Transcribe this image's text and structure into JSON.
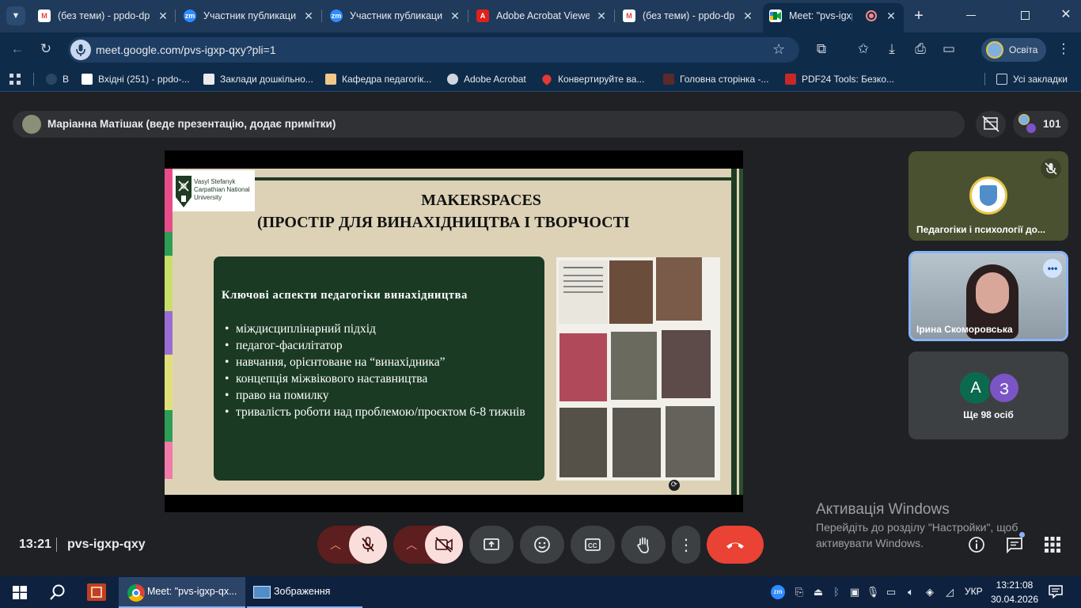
{
  "tabs": [
    {
      "label": "(без теми) - ppdo-dp",
      "icon": "gmail-icon"
    },
    {
      "label": "Участник публикаци",
      "icon": "zoom-icon"
    },
    {
      "label": "Участник публикаци",
      "icon": "zoom-icon"
    },
    {
      "label": "Adobe Acrobat Viewe",
      "icon": "acrobat-icon"
    },
    {
      "label": "(без теми) - ppdo-dp",
      "icon": "gmail-icon"
    },
    {
      "label": "Meet: \"pvs-igxp-q",
      "icon": "meet-icon"
    }
  ],
  "address": {
    "url": "meet.google.com/pvs-igxp-qxy?pli=1"
  },
  "profile": {
    "label": "Освіта"
  },
  "bookmarks": {
    "items": [
      "В",
      "Вхідні (251) - ppdo-...",
      "Заклади дошкільно...",
      "Кафедра педагогік...",
      "Adobe Acrobat",
      "Конвертируйте ва...",
      "Головна сторінка -...",
      "PDF24 Tools: Безко..."
    ],
    "all_label": "Усі закладки"
  },
  "presenter": {
    "text": "Маріанна Матішак (веде презентацію, додає примітки)",
    "participant_count": "101"
  },
  "slide": {
    "logo_lines": [
      "Vasyl Stefanyk",
      "Carpathian National",
      "University"
    ],
    "title_line1": "MAKERSPACES",
    "title_line2": "(ПРОСТІР ДЛЯ ВИНАХІДНИЦТВА І ТВОРЧОСТІ",
    "box_heading": "Ключові аспекти педагогіки винахідництва",
    "bullets": [
      "міждисциплінарний підхід",
      "педагог-фасилітатор",
      "навчання, орієнтоване на “винахідника”",
      "концепція міжвікового наставництва",
      "право на помилку",
      "тривалість роботи над проблемою/проєктом 6-8 тижнів"
    ]
  },
  "tiles": {
    "tile1_name": "Педагогіки і психології до...",
    "tile2_name": "Ірина Скоморовська",
    "others_avatar1": "А",
    "others_avatar2": "З",
    "others_label": "Ще 98 осіб"
  },
  "meeting": {
    "time": "13:21",
    "code": "pvs-igxp-qxy"
  },
  "activation": {
    "title": "Активація Windows",
    "line1": "Перейдіть до розділу \"Настройки\", щоб",
    "line2": "активувати Windows."
  },
  "taskbar": {
    "chrome_label": "Meet: \"pvs-igxp-qx...",
    "images_label": "Зображення",
    "lang": "УКР",
    "time": "13:21:08",
    "date": "30.04.2026"
  },
  "colors": {
    "end_call": "#ea4335",
    "muted": "#f9dedc",
    "accent": "#8ab4f8"
  }
}
